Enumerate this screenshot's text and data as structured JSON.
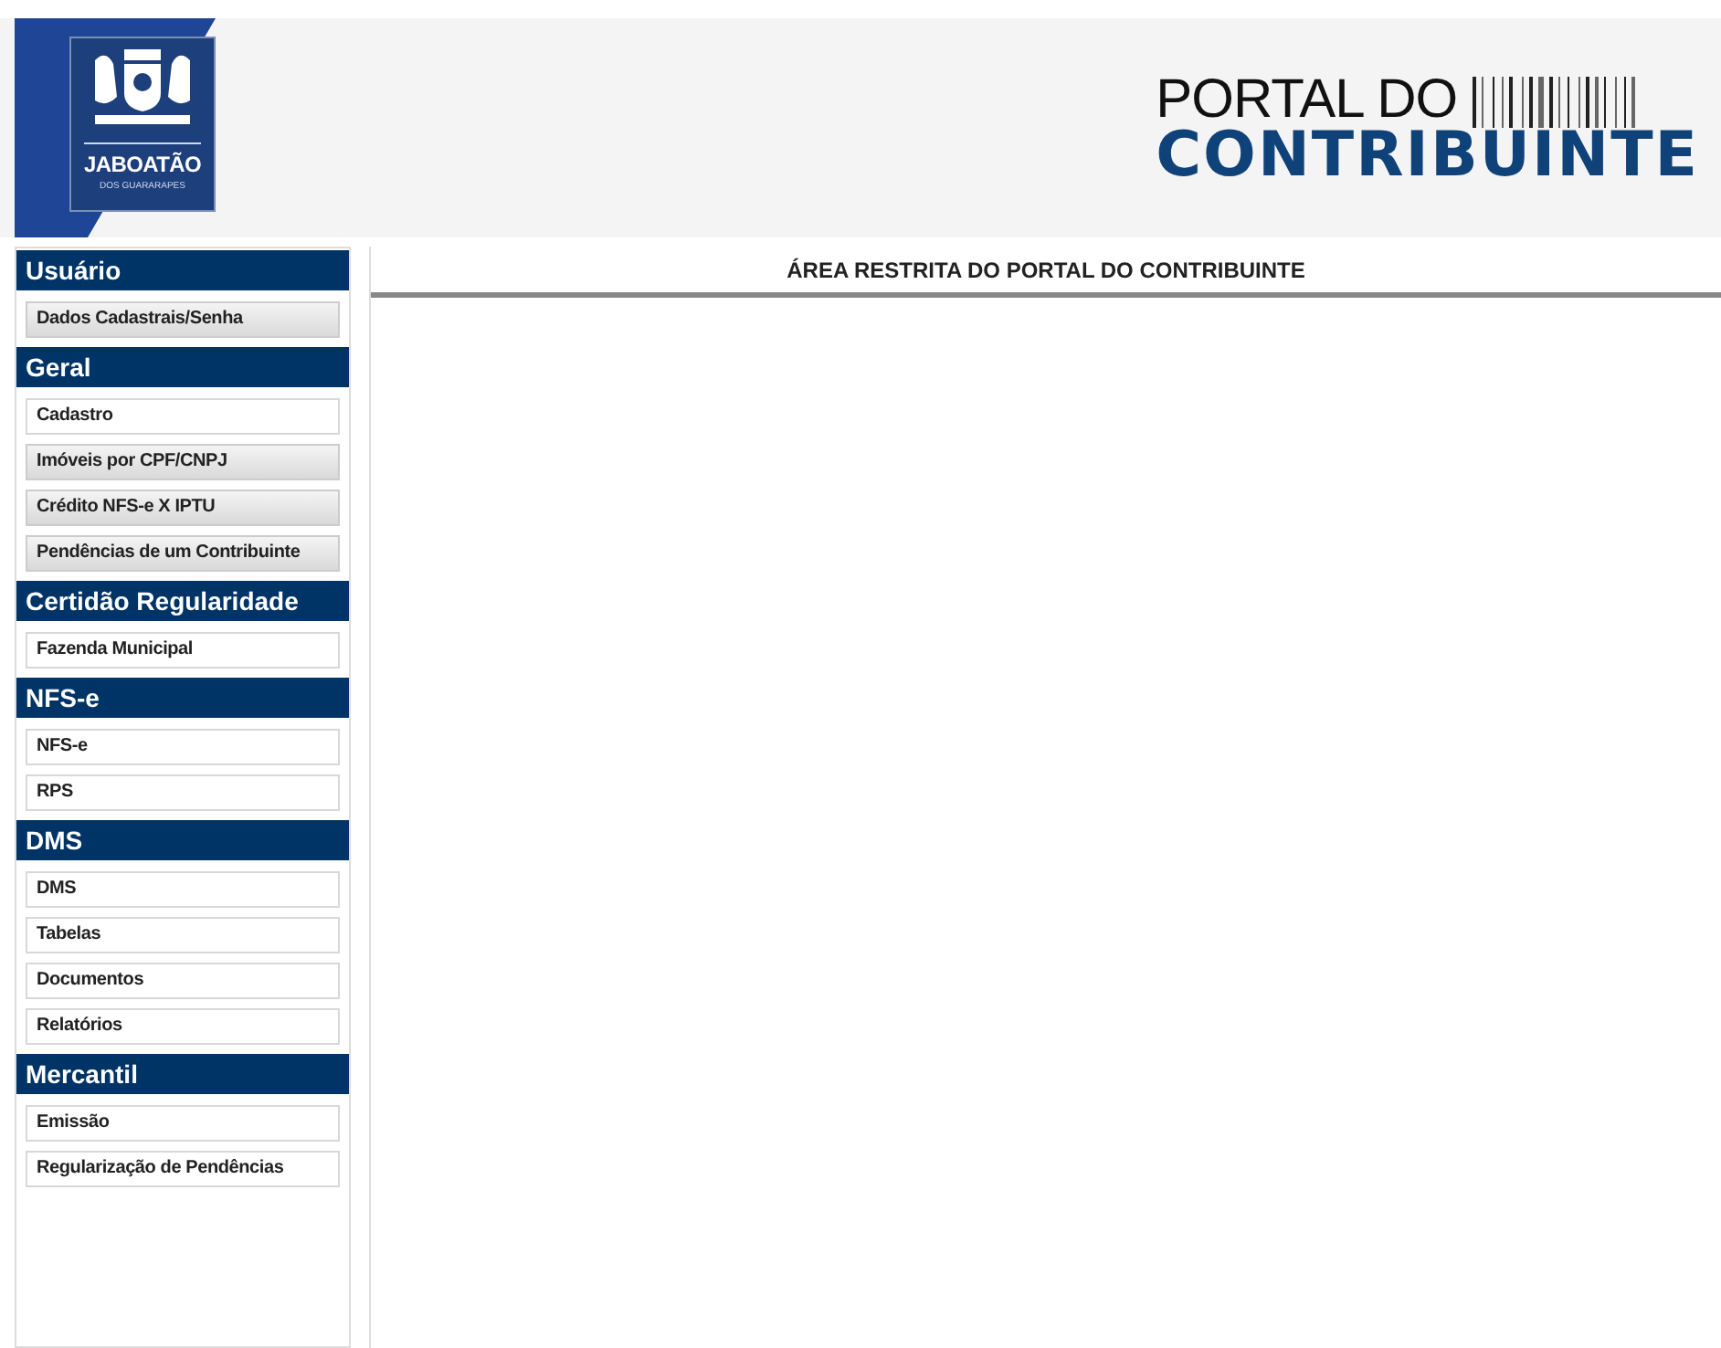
{
  "header": {
    "logo": {
      "line_1": "JABOATÃO",
      "line_2": "DOS GUARARAPES"
    },
    "portal_title": {
      "line_1": "PORTAL DO",
      "line_2": "CONTRIBUINTE"
    }
  },
  "sidebar": {
    "sections": [
      {
        "heading": "Usuário",
        "items": [
          {
            "label": "Dados Cadastrais/Senha",
            "highlighted": true
          }
        ]
      },
      {
        "heading": "Geral",
        "items": [
          {
            "label": "Cadastro",
            "highlighted": false
          },
          {
            "label": "Imóveis por CPF/CNPJ",
            "highlighted": true
          },
          {
            "label": "Crédito NFS-e X IPTU",
            "highlighted": true
          },
          {
            "label": "Pendências de um Contribuinte",
            "highlighted": true
          }
        ]
      },
      {
        "heading": "Certidão Regularidade",
        "items": [
          {
            "label": "Fazenda Municipal",
            "highlighted": false
          }
        ]
      },
      {
        "heading": "NFS-e",
        "items": [
          {
            "label": "NFS-e",
            "highlighted": false
          },
          {
            "label": "RPS",
            "highlighted": false
          }
        ]
      },
      {
        "heading": "DMS",
        "items": [
          {
            "label": "DMS",
            "highlighted": false
          },
          {
            "label": "Tabelas",
            "highlighted": false
          },
          {
            "label": "Documentos",
            "highlighted": false
          },
          {
            "label": "Relatórios",
            "highlighted": false
          }
        ]
      },
      {
        "heading": "Mercantil",
        "items": [
          {
            "label": "Emissão",
            "highlighted": false
          },
          {
            "label": "Regularização de Pendências",
            "highlighted": false
          }
        ]
      }
    ]
  },
  "main": {
    "title": "ÁREA RESTRITA DO PORTAL DO CONTRIBUINTE"
  }
}
